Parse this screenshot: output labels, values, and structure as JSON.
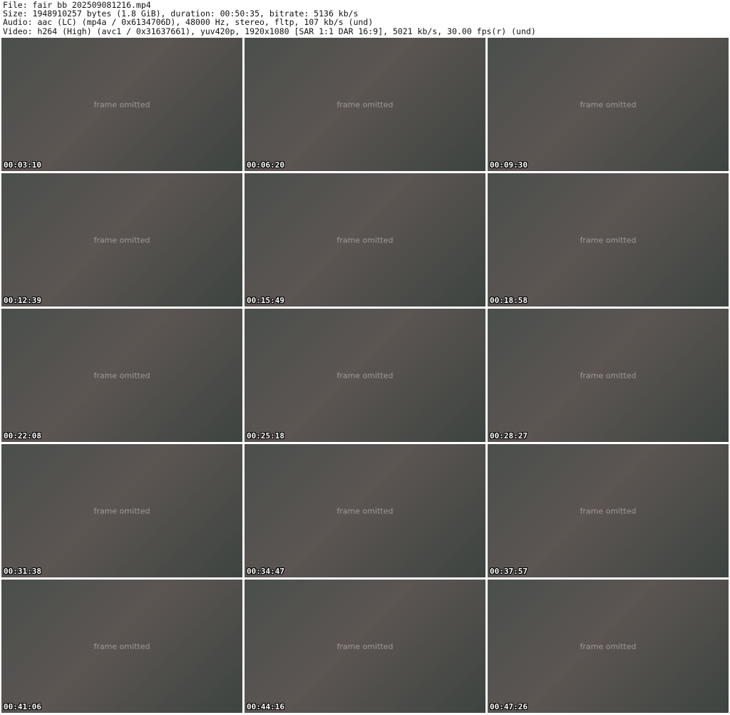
{
  "header": {
    "file_line": "File: fair_bb_202509081216.mp4",
    "size_line": "Size: 1948910257 bytes (1.8 GiB), duration: 00:50:35, bitrate: 5136 kb/s",
    "audio_line": "Audio: aac (LC) (mp4a / 0x6134706D), 48000 Hz, stereo, fltp, 107 kb/s (und)",
    "video_line": "Video: h264 (High) (avc1 / 0x31637661), yuv420p, 1920x1080 [SAR 1:1 DAR 16:9], 5021 kb/s, 30.00 fps(r) (und)"
  },
  "thumbnails": [
    "00:03:10",
    "00:06:20",
    "00:09:30",
    "00:12:39",
    "00:15:49",
    "00:18:58",
    "00:22:08",
    "00:25:18",
    "00:28:27",
    "00:31:38",
    "00:34:47",
    "00:37:57",
    "00:41:06",
    "00:44:16",
    "00:47:26"
  ],
  "placeholder_note": "frame omitted"
}
